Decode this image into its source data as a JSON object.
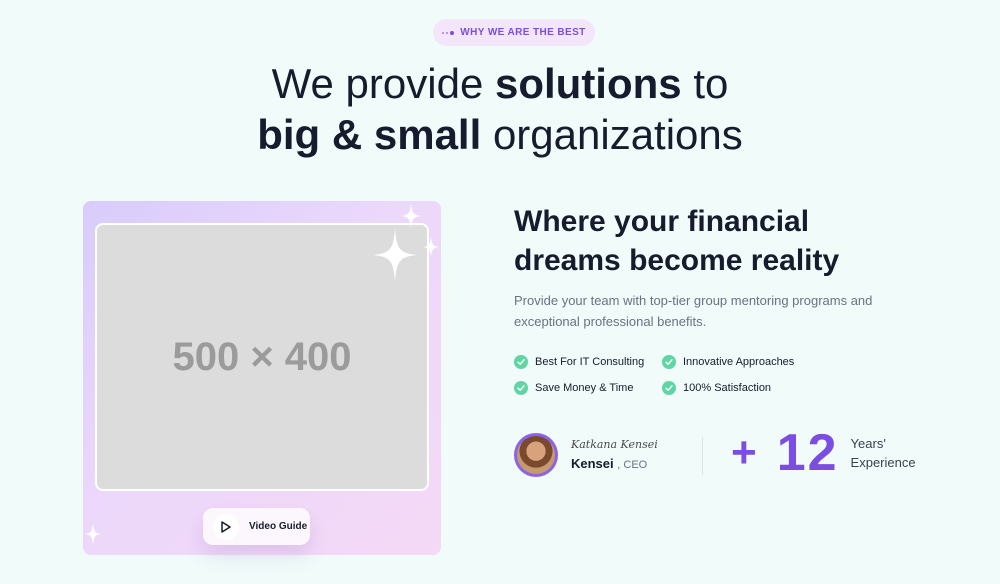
{
  "badge": {
    "label": "WHY WE ARE THE BEST"
  },
  "headline": {
    "line1_pre": "We provide ",
    "line1_bold": "solutions",
    "line1_post": " to",
    "line2_bold": "big & small",
    "line2_post": " organizations"
  },
  "media": {
    "placeholder_text": "500 × 400",
    "video_button_label": "Video Guide",
    "gradient_colors": [
      "#d8ccfb",
      "#ecd8fb",
      "#f5d9f6"
    ]
  },
  "info": {
    "title_line1": "Where your financial",
    "title_line2": "dreams become reality",
    "description": "Provide your team with top-tier group mentoring programs and exceptional professional benefits."
  },
  "features": [
    {
      "label": "Best For IT Consulting",
      "icon": "check-circle-icon"
    },
    {
      "label": "Innovative Approaches",
      "icon": "check-circle-icon"
    },
    {
      "label": "Save Money & Time",
      "icon": "check-circle-icon"
    },
    {
      "label": "100% Satisfaction",
      "icon": "check-circle-icon"
    }
  ],
  "author": {
    "signature": "Katkana Kensei",
    "name": "Kensei",
    "role": ", CEO"
  },
  "stat": {
    "prefix": "+",
    "value": "12",
    "label_line1": "Years'",
    "label_line2": "Experience"
  },
  "colors": {
    "accent": "#7b4de0",
    "check": "#5fd4a4",
    "background": "#f1fbfa",
    "text": "#161c2d"
  }
}
